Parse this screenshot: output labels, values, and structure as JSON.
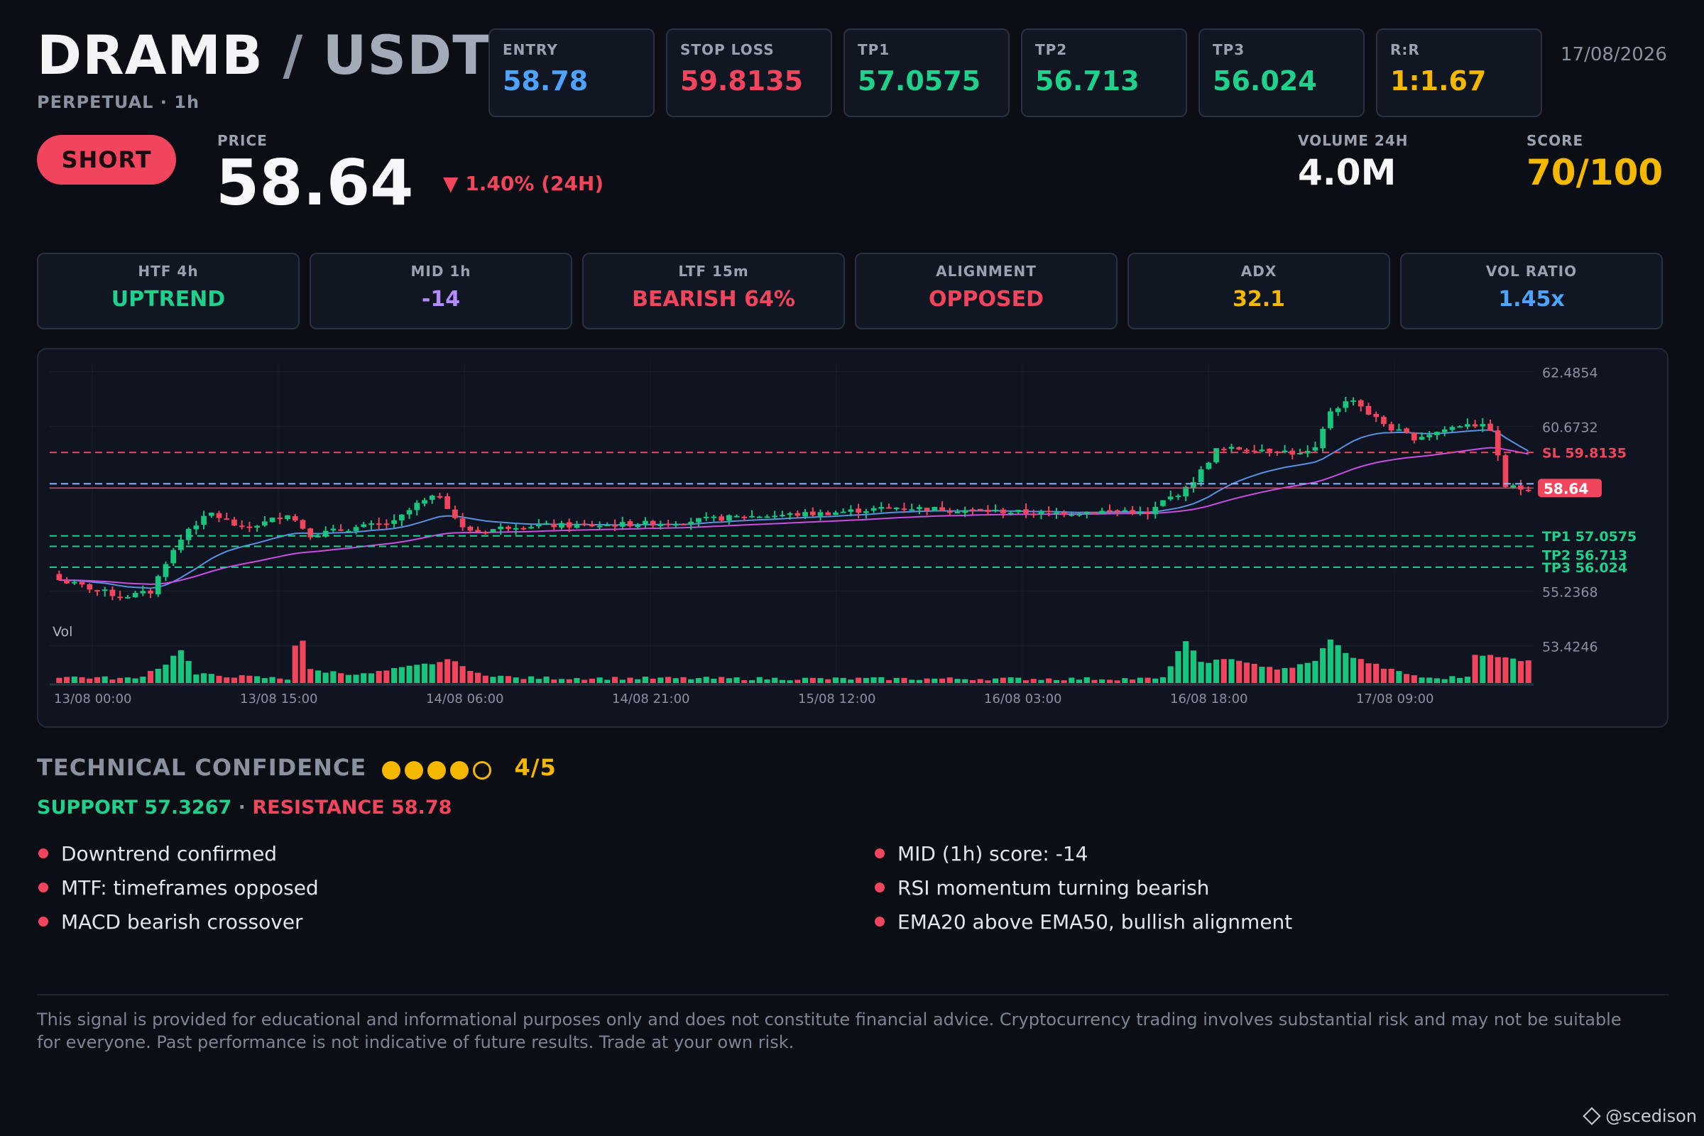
{
  "header": {
    "base": "DRAMB",
    "sep": " / ",
    "quote": "USDT",
    "subtitle": "PERPETUAL · 1h",
    "date": "17/08/2026"
  },
  "levels": [
    {
      "label": "ENTRY",
      "value": "58.78",
      "color": "#4ea3ff"
    },
    {
      "label": "STOP LOSS",
      "value": "59.8135",
      "color": "#f1445d"
    },
    {
      "label": "TP1",
      "value": "57.0575",
      "color": "#1fd18a"
    },
    {
      "label": "TP2",
      "value": "56.713",
      "color": "#1fd18a"
    },
    {
      "label": "TP3",
      "value": "56.024",
      "color": "#1fd18a"
    },
    {
      "label": "R:R",
      "value": "1:1.67",
      "color": "#f5b800"
    }
  ],
  "signal": {
    "side": "SHORT",
    "price_label": "PRICE",
    "price": "58.64",
    "change": "▼ 1.40% (24H)",
    "volume_label": "VOLUME 24H",
    "volume": "4.0M",
    "score_label": "SCORE",
    "score": "70/100"
  },
  "indicators": [
    {
      "label": "HTF 4h",
      "value": "UPTREND",
      "color": "#1fd18a"
    },
    {
      "label": "MID 1h",
      "value": "-14",
      "color": "#b48cff"
    },
    {
      "label": "LTF 15m",
      "value": "BEARISH 64%",
      "color": "#f1445d"
    },
    {
      "label": "ALIGNMENT",
      "value": "OPPOSED",
      "color": "#f1445d"
    },
    {
      "label": "ADX",
      "value": "32.1",
      "color": "#f5b800"
    },
    {
      "label": "VOL RATIO",
      "value": "1.45x",
      "color": "#4ea3ff"
    }
  ],
  "chart_data": {
    "type": "candlestick",
    "y_ticks": [
      "62.4854",
      "60.6732",
      "55.2368",
      "53.4246"
    ],
    "x_ticks": [
      "13/08 00:00",
      "13/08 15:00",
      "14/08 06:00",
      "14/08 21:00",
      "15/08 12:00",
      "16/08 03:00",
      "16/08 18:00",
      "17/08 09:00"
    ],
    "ylim": [
      52.9,
      62.8
    ],
    "volume_label": "Vol",
    "grid": true,
    "lines": [
      {
        "label": "SL 59.8135",
        "value": 59.8135,
        "color": "#f1445d",
        "style": "dashed"
      },
      {
        "label": "58.78",
        "value": 58.78,
        "color": "#8fb6ff",
        "style": "dashed"
      },
      {
        "label": "TP1 57.0575",
        "value": 57.0575,
        "color": "#1fd18a",
        "style": "dashed"
      },
      {
        "label": "TP2 56.713",
        "value": 56.713,
        "color": "#1fd18a",
        "style": "dashed"
      },
      {
        "label": "TP3 56.024",
        "value": 56.024,
        "color": "#1fd18a",
        "style": "dashed"
      }
    ],
    "current_price": {
      "label": "58.64",
      "value": 58.64,
      "color": "#f1445d"
    },
    "close_anchors": [
      [
        0,
        55.6
      ],
      [
        6,
        55.2
      ],
      [
        8,
        55.05
      ],
      [
        12,
        55.2
      ],
      [
        14,
        56.2
      ],
      [
        17,
        57.3
      ],
      [
        20,
        57.8
      ],
      [
        24,
        57.3
      ],
      [
        27,
        57.5
      ],
      [
        30,
        57.8
      ],
      [
        33,
        57.1
      ],
      [
        38,
        57.3
      ],
      [
        44,
        57.5
      ],
      [
        47,
        58.1
      ],
      [
        50,
        58.4
      ],
      [
        53,
        57.3
      ],
      [
        55,
        57.2
      ],
      [
        60,
        57.4
      ],
      [
        70,
        57.4
      ],
      [
        80,
        57.5
      ],
      [
        90,
        57.7
      ],
      [
        100,
        57.8
      ],
      [
        110,
        58.0
      ],
      [
        120,
        57.9
      ],
      [
        130,
        57.8
      ],
      [
        140,
        57.9
      ],
      [
        143,
        57.75
      ],
      [
        145,
        58.2
      ],
      [
        148,
        58.6
      ],
      [
        150,
        59.2
      ],
      [
        152,
        59.9
      ],
      [
        156,
        59.95
      ],
      [
        160,
        59.9
      ],
      [
        163,
        59.75
      ],
      [
        165,
        59.9
      ],
      [
        167,
        61.2
      ],
      [
        170,
        61.6
      ],
      [
        172,
        61.1
      ],
      [
        175,
        60.6
      ],
      [
        178,
        60.3
      ],
      [
        181,
        60.5
      ],
      [
        185,
        60.8
      ],
      [
        188,
        60.6
      ],
      [
        190,
        58.7
      ],
      [
        192,
        58.62
      ],
      [
        193,
        58.64
      ]
    ],
    "volume_anchors": [
      [
        0,
        0.15
      ],
      [
        10,
        0.1
      ],
      [
        14,
        0.45
      ],
      [
        16,
        0.8
      ],
      [
        18,
        0.2
      ],
      [
        30,
        0.1
      ],
      [
        31,
        0.9
      ],
      [
        32,
        1.0
      ],
      [
        33,
        0.3
      ],
      [
        40,
        0.2
      ],
      [
        52,
        0.55
      ],
      [
        54,
        0.25
      ],
      [
        60,
        0.12
      ],
      [
        100,
        0.1
      ],
      [
        145,
        0.1
      ],
      [
        147,
        0.75
      ],
      [
        148,
        0.95
      ],
      [
        150,
        0.5
      ],
      [
        155,
        0.55
      ],
      [
        160,
        0.3
      ],
      [
        165,
        0.5
      ],
      [
        166,
        0.85
      ],
      [
        167,
        1.0
      ],
      [
        170,
        0.6
      ],
      [
        175,
        0.3
      ],
      [
        180,
        0.1
      ],
      [
        185,
        0.15
      ],
      [
        186,
        0.7
      ],
      [
        189,
        0.6
      ],
      [
        192,
        0.55
      ]
    ]
  },
  "confidence": {
    "title": "TECHNICAL CONFIDENCE",
    "filled": 4,
    "total": 5,
    "score": "4/5",
    "support": "SUPPORT 57.3267",
    "sep": " · ",
    "resistance": "RESISTANCE 58.78"
  },
  "bullets_left": [
    "Downtrend confirmed",
    "MTF: timeframes opposed",
    "MACD bearish crossover"
  ],
  "bullets_right": [
    "MID (1h) score: -14",
    "RSI momentum turning bearish",
    "EMA20 above EMA50, bullish alignment"
  ],
  "disclaimer": "This signal is provided for educational and informational purposes only and does not constitute financial advice. Cryptocurrency trading involves substantial risk and may not be suitable for everyone. Past performance is not indicative of future results. Trade at your own risk.",
  "brand": "@scedison"
}
